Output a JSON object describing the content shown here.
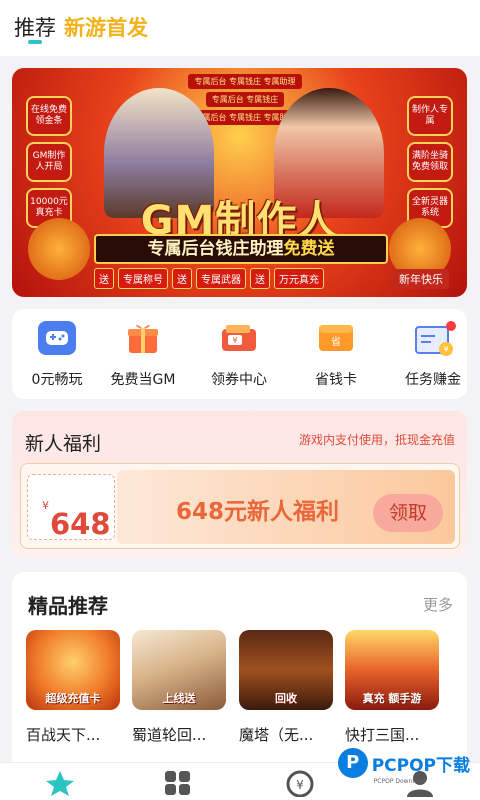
{
  "header": {
    "tabs": [
      "推荐",
      "新游首发"
    ],
    "active_tab": "推荐",
    "accent_color": "#2bc4c0",
    "new_tab_color": "#f2b21b"
  },
  "banner": {
    "title": "GM制作人",
    "subtitle_prefix": "专属后台钱庄助理",
    "subtitle_suffix": "免费送",
    "top_chips": [
      "专属后台 专属钱庄 专属助理",
      "专属后台 专属钱庄",
      "专属后台 专属钱庄 专属助理"
    ],
    "left_tags": [
      "在线免费领金条",
      "GM制作人开局",
      "10000元真充卡"
    ],
    "right_tags": [
      "制作人专属",
      "满阶坐骑免费领取",
      "全新灵器系统"
    ],
    "give_items": [
      "送",
      "专属称号",
      "送",
      "专属武器",
      "送",
      "万元真充"
    ],
    "new_year": "新年快乐"
  },
  "quick_entries": [
    {
      "label": "0元畅玩",
      "icon": "gamepad-icon"
    },
    {
      "label": "免费当GM",
      "icon": "gift-box-icon"
    },
    {
      "label": "领券中心",
      "icon": "wallet-icon"
    },
    {
      "label": "省钱卡",
      "icon": "savings-card-icon"
    },
    {
      "label": "任务赚金",
      "icon": "task-board-icon"
    }
  ],
  "welfare": {
    "title": "新人福利",
    "note": "游戏内支付使用，抵现金充值",
    "coupon_currency": "¥",
    "coupon_amount": "648",
    "coupon_title": "648元新人福利",
    "claim_label": "领取"
  },
  "featured": {
    "title": "精品推荐",
    "more_label": "更多",
    "games": [
      {
        "name": "百战天下...",
        "thumb_text": "超级充值卡"
      },
      {
        "name": "蜀道轮回...",
        "thumb_text": "上线送"
      },
      {
        "name": "魔塔（无...",
        "thumb_text": "回收"
      },
      {
        "name": "快打三国...",
        "thumb_text": "真充 额手游"
      }
    ]
  },
  "bottom_nav": [
    {
      "icon": "star-icon",
      "active": true
    },
    {
      "icon": "grid-icon",
      "active": false
    },
    {
      "icon": "coin-icon",
      "active": false
    },
    {
      "icon": "user-icon",
      "active": false
    }
  ],
  "watermark": {
    "logo_letter": "P",
    "text": "PCPOP下载",
    "sub": "PCPOP Download"
  }
}
